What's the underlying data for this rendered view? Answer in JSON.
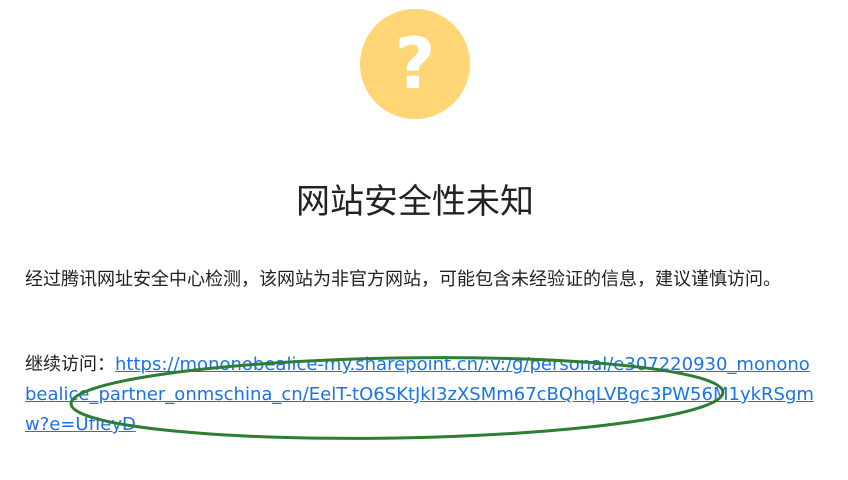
{
  "status_icon": {
    "icon": "question-mark-icon",
    "glyph": "?",
    "color": "#ffd575"
  },
  "title": "网站安全性未知",
  "warning": {
    "text": "经过腾讯网址安全中心检测，该网站为非官方网站，可能包含未经验证的信息，建议谨慎访问。"
  },
  "continue": {
    "label": "继续访问：",
    "url": "https://mononobealice-my.sharepoint.cn/:v:/g/personal/e307220930_mononobealice_partner_onmschina_cn/EelT-tO6SKtJkI3zXSMm67cBQhqLVBgc3PW56M1ykRSgmw?e=UfIeyD",
    "link_color": "#1a73e8"
  },
  "annotation": {
    "shape": "ellipse",
    "color": "#2e7d32"
  }
}
